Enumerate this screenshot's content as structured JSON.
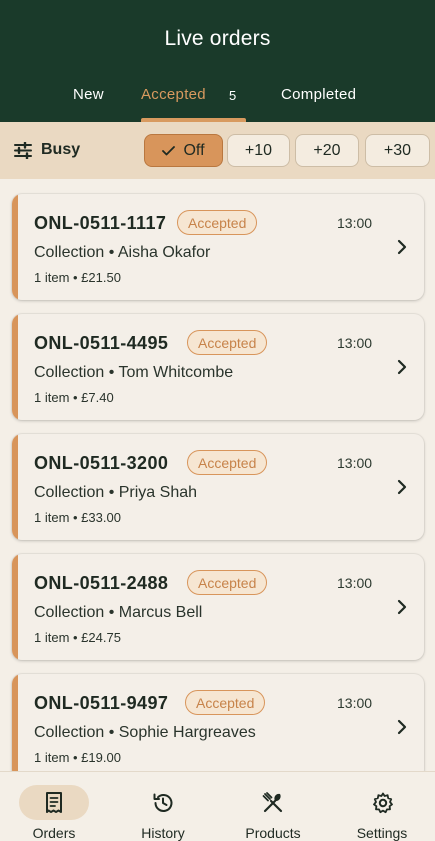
{
  "header": {
    "title": "Live orders"
  },
  "tabs": [
    {
      "label": "New"
    },
    {
      "label": "Accepted",
      "count": "5"
    },
    {
      "label": "Completed"
    }
  ],
  "busy": {
    "label": "Busy",
    "options": [
      {
        "label": "Off",
        "selected": true
      },
      {
        "label": "+10"
      },
      {
        "label": "+20"
      },
      {
        "label": "+30"
      }
    ]
  },
  "orders": [
    {
      "id": "ONL-0511-1117",
      "status": "Accepted",
      "time": "13:00",
      "type_customer": "Collection • Aisha Okafor",
      "summary": "1 item • £21.50"
    },
    {
      "id": "ONL-0511-4495",
      "status": "Accepted",
      "time": "13:00",
      "type_customer": "Collection • Tom Whitcombe",
      "summary": "1 item • £7.40"
    },
    {
      "id": "ONL-0511-3200",
      "status": "Accepted",
      "time": "13:00",
      "type_customer": "Collection • Priya Shah",
      "summary": "1 item • £33.00"
    },
    {
      "id": "ONL-0511-2488",
      "status": "Accepted",
      "time": "13:00",
      "type_customer": "Collection • Marcus Bell",
      "summary": "1 item • £24.75"
    },
    {
      "id": "ONL-0511-9497",
      "status": "Accepted",
      "time": "13:00",
      "type_customer": "Collection • Sophie Hargreaves",
      "summary": "1 item • £19.00"
    }
  ],
  "nav": [
    {
      "label": "Orders",
      "icon": "receipt-icon",
      "active": true
    },
    {
      "label": "History",
      "icon": "history-icon"
    },
    {
      "label": "Products",
      "icon": "utensils-icon"
    },
    {
      "label": "Settings",
      "icon": "gear-icon"
    }
  ],
  "colors": {
    "header_bg": "#1a3a2a",
    "accent": "#d8955b",
    "background": "#f4efe7"
  }
}
